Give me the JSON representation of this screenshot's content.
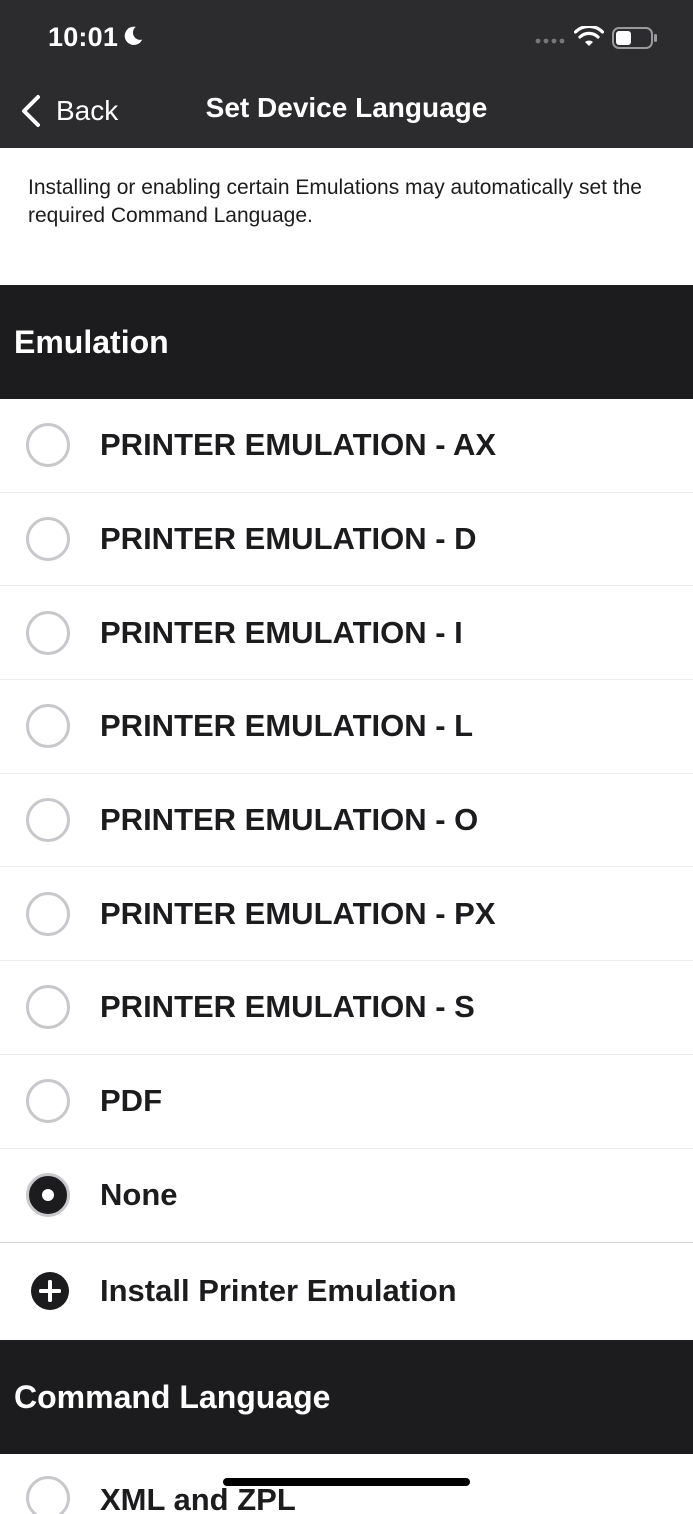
{
  "status_bar": {
    "time": "10:01",
    "icons": [
      "moon-icon",
      "cellular-signal-icon",
      "wifi-icon",
      "battery-icon"
    ]
  },
  "nav": {
    "back_label": "Back",
    "title": "Set Device Language"
  },
  "info_text": "Installing or enabling certain Emulations may automatically set the required Command Language.",
  "emulation": {
    "header": "Emulation",
    "options": [
      {
        "label": "PRINTER EMULATION - AX",
        "selected": false
      },
      {
        "label": "PRINTER EMULATION - D",
        "selected": false
      },
      {
        "label": "PRINTER EMULATION - I",
        "selected": false
      },
      {
        "label": "PRINTER EMULATION - L",
        "selected": false
      },
      {
        "label": "PRINTER EMULATION - O",
        "selected": false
      },
      {
        "label": "PRINTER EMULATION - PX",
        "selected": false
      },
      {
        "label": "PRINTER EMULATION - S",
        "selected": false
      },
      {
        "label": "PDF",
        "selected": false
      },
      {
        "label": "None",
        "selected": true
      }
    ],
    "install_label": "Install Printer Emulation"
  },
  "command_language": {
    "header": "Command Language",
    "options": [
      {
        "label": "XML and ZPL",
        "selected": false
      }
    ]
  },
  "colors": {
    "bar_bg": "#2c2c2e",
    "section_bg": "#1c1c1e",
    "radio_border": "#c7c7cc"
  }
}
